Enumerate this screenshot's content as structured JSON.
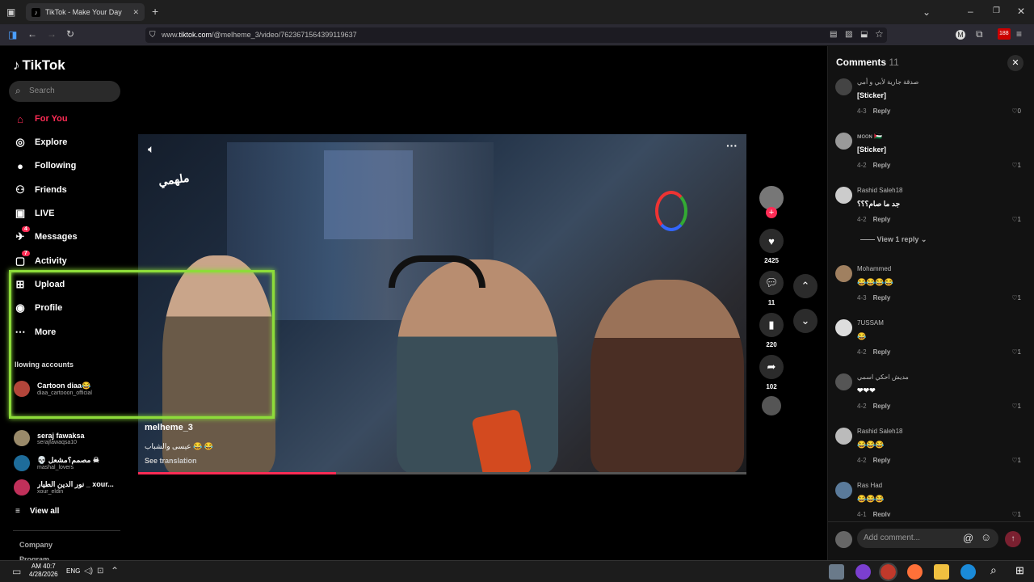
{
  "browser": {
    "tab_title": "TikTok - Make Your Day",
    "url_prefix": "www.",
    "url_domain": "tiktok.com",
    "url_path": "/@melheme_3/video/7623671564399119637",
    "ext_badge": "188"
  },
  "sidebar": {
    "logo": "TikTok",
    "search_placeholder": "Search",
    "nav": [
      {
        "label": "For You",
        "icon": "home-icon"
      },
      {
        "label": "Explore",
        "icon": "compass-icon"
      },
      {
        "label": "Following",
        "icon": "following-avatar"
      },
      {
        "label": "Friends",
        "icon": "friends-icon"
      },
      {
        "label": "LIVE",
        "icon": "live-icon"
      },
      {
        "label": "Messages",
        "icon": "messages-icon",
        "badge": "4"
      },
      {
        "label": "Activity",
        "icon": "activity-icon",
        "badge": "7"
      },
      {
        "label": "Upload",
        "icon": "upload-icon"
      },
      {
        "label": "Profile",
        "icon": "profile-icon"
      },
      {
        "label": "More",
        "icon": "more-icon"
      }
    ],
    "following_title": "llowing accounts",
    "accounts": [
      {
        "name": "Cartoon diaa😂",
        "handle": "diaa_cartooon_official"
      },
      {
        "name": "seraj fawaksa",
        "handle": "serajfawaqsa10"
      },
      {
        "name": "💀 مصمم؟مشعل ☠",
        "handle": "mashal_lovers"
      },
      {
        "name": "نور الدين الطيار _ xour...",
        "handle": "xour_eldin"
      }
    ],
    "view_all": "View all",
    "footer": [
      "Company",
      "Program"
    ]
  },
  "video": {
    "watermark": "ملهمي",
    "author": "melheme_3",
    "caption": "عيسى والشباب 😂 😂",
    "see_translation": "See translation",
    "progress": 0.325
  },
  "actions": {
    "likes": "2425",
    "comments": "11",
    "saves": "220",
    "shares": "102"
  },
  "comments_panel": {
    "title": "Comments",
    "count": "11",
    "reply_label": "Reply",
    "add_placeholder": "Add comment...",
    "items": [
      {
        "user": "صدقة جارية لأبي و أمي",
        "text": "[Sticker]",
        "date": "4-3",
        "likes": "0"
      },
      {
        "user": "ᴍᴏᴏɴ 🇵🇸",
        "text": "[Sticker]",
        "date": "4-2",
        "likes": "1"
      },
      {
        "user": "Rashid Saleh18",
        "text": "جد ما صام؟؟؟",
        "date": "4-2",
        "likes": "1",
        "view_replies": "View 1 reply"
      },
      {
        "user": "Mohammed",
        "text": "😂😂😂😂",
        "date": "4-3",
        "likes": "1"
      },
      {
        "user": "7USSAM",
        "text": "😂",
        "date": "4-2",
        "likes": "1"
      },
      {
        "user": "مديش احكي اسمي",
        "text": "❤❤❤",
        "date": "4-2",
        "likes": "1"
      },
      {
        "user": "Rashid Saleh18",
        "text": "😂😂😂",
        "date": "4-2",
        "likes": "1"
      },
      {
        "user": "Ras Had",
        "text": "😂😂😂",
        "date": "4-1",
        "likes": "1"
      }
    ]
  },
  "taskbar": {
    "time": "AM 40:7",
    "date": "4/28/2026",
    "lang": "ENG"
  }
}
